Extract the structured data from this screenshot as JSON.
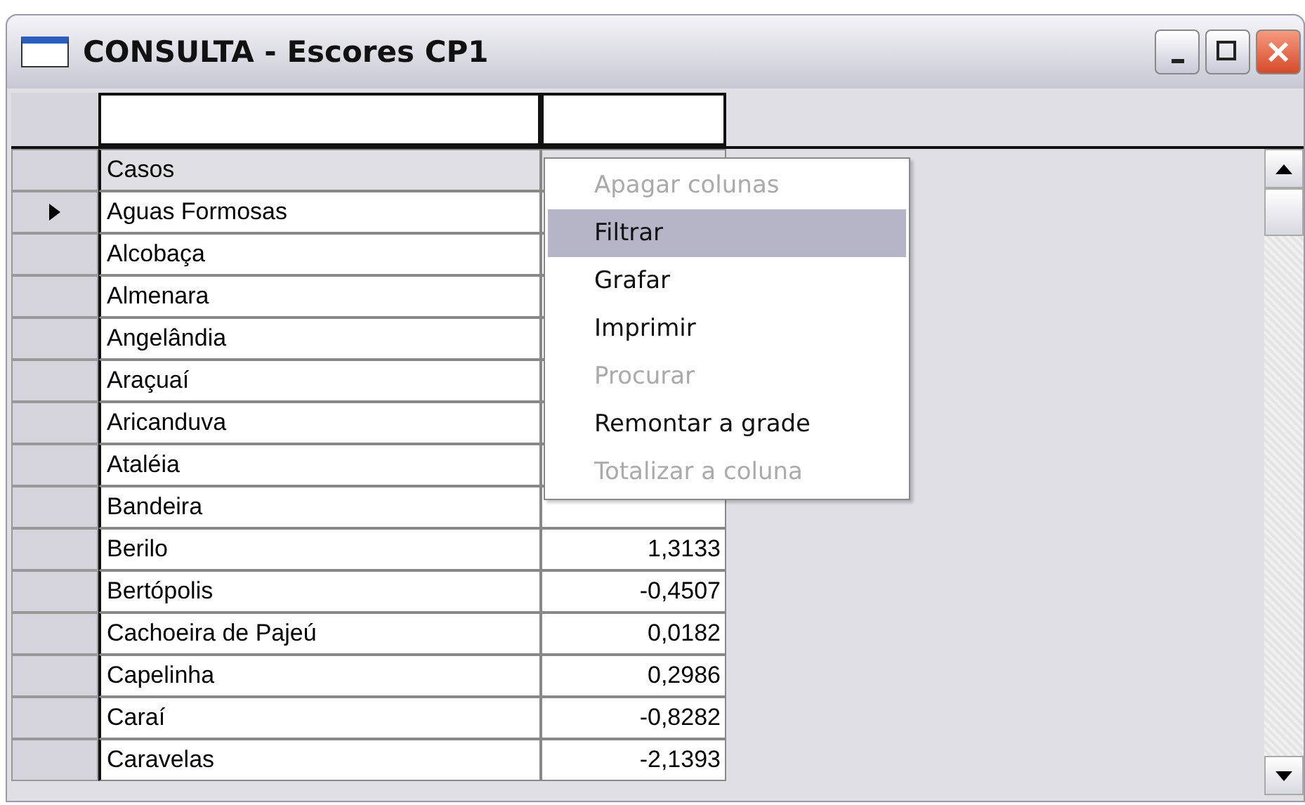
{
  "window": {
    "title": "CONSULTA - Escores CP1"
  },
  "filter_row": [
    {
      "kind": "field"
    },
    {
      "kind": "field"
    }
  ],
  "table": {
    "columns": [
      "Casos"
    ],
    "rows": [
      {
        "current": true,
        "name": "Aguas Formosas"
      },
      {
        "current": false,
        "name": "Alcobaça"
      },
      {
        "current": false,
        "name": "Almenara"
      },
      {
        "current": false,
        "name": "Angelândia"
      },
      {
        "current": false,
        "name": "Araçuaí"
      },
      {
        "current": false,
        "name": "Aricanduva"
      },
      {
        "current": false,
        "name": "Ataléia"
      },
      {
        "current": false,
        "name": "Bandeira"
      },
      {
        "current": false,
        "name": "Berilo",
        "value": "1,3133"
      },
      {
        "current": false,
        "name": "Bertópolis",
        "value": "-0,4507"
      },
      {
        "current": false,
        "name": "Cachoeira de Pajeú",
        "value": "0,0182"
      },
      {
        "current": false,
        "name": "Capelinha",
        "value": "0,2986"
      },
      {
        "current": false,
        "name": "Caraí",
        "value": "-0,8282"
      },
      {
        "current": false,
        "name": "Caravelas",
        "value": "-2,1393"
      }
    ]
  },
  "context_menu": [
    {
      "label": "Apagar colunas",
      "disabled": true,
      "selected": false
    },
    {
      "label": "Filtrar",
      "disabled": false,
      "selected": true
    },
    {
      "label": "Grafar",
      "disabled": false,
      "selected": false
    },
    {
      "label": "Imprimir",
      "disabled": false,
      "selected": false
    },
    {
      "label": "Procurar",
      "disabled": true,
      "selected": false
    },
    {
      "label": "Remontar a grade",
      "disabled": false,
      "selected": false
    },
    {
      "label": "Totalizar a coluna",
      "disabled": true,
      "selected": false
    }
  ]
}
